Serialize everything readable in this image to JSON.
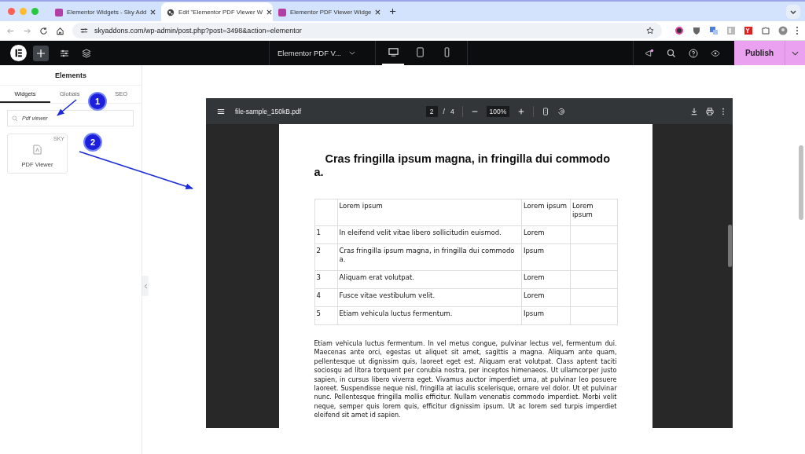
{
  "browser": {
    "tabs": [
      {
        "title": "Elementor Widgets - Sky Add",
        "kind": "brand",
        "selected": false
      },
      {
        "title": "Edit \"Elementor PDF Viewer W",
        "kind": "globe",
        "selected": true
      },
      {
        "title": "Elementor PDF Viewer Widge",
        "kind": "brand",
        "selected": false
      }
    ],
    "url": "skyaddons.com/wp-admin/post.php?post=3498&action=elementor"
  },
  "editor": {
    "document_title": "Elementor PDF V...",
    "devices": [
      {
        "kind": "desktop",
        "selected": true
      },
      {
        "kind": "tablet",
        "selected": false
      },
      {
        "kind": "mobile",
        "selected": false
      }
    ],
    "publish": "Publish"
  },
  "sidebar": {
    "title": "Elements",
    "tabs": [
      {
        "label": "Widgets",
        "selected": true
      },
      {
        "label": "Globals",
        "selected": false
      },
      {
        "label": "SEO",
        "selected": false
      }
    ],
    "search": {
      "value": "Pdf viewer"
    },
    "widgets": [
      {
        "label": "PDF Viewer",
        "badge": "SKY"
      }
    ]
  },
  "annotations": [
    {
      "label": "1"
    },
    {
      "label": "2"
    }
  ],
  "pdf": {
    "filename": "file-sample_150kB.pdf",
    "page": "2",
    "separator": "/",
    "total": "4",
    "zoom": "100%",
    "heading": "Cras fringilla ipsum magna, in fringilla dui commodo a.",
    "table": {
      "columns": [
        "",
        "Lorem ipsum",
        "Lorem ipsum",
        "Lorem ipsum"
      ],
      "rows": [
        [
          "1",
          "In eleifend velit vitae libero sollicitudin euismod.",
          "Lorem",
          ""
        ],
        [
          "2",
          "Cras fringilla ipsum magna, in fringilla dui commodo a.",
          "Ipsum",
          ""
        ],
        [
          "3",
          "Aliquam erat volutpat.",
          "Lorem",
          ""
        ],
        [
          "4",
          "Fusce vitae vestibulum velit.",
          "Lorem",
          ""
        ],
        [
          "5",
          "Etiam vehicula luctus fermentum.",
          "Ipsum",
          ""
        ]
      ]
    },
    "paragraph": "Etiam vehicula luctus fermentum. In vel metus congue, pulvinar lectus vel, fermentum dui. Maecenas ante orci, egestas ut aliquet sit amet, sagittis a magna. Aliquam ante quam, pellentesque ut dignissim quis, laoreet eget est. Aliquam erat volutpat. Class aptent taciti sociosqu ad litora torquent per conubia nostra, per inceptos himenaeos. Ut ullamcorper justo sapien, in cursus libero viverra eget. Vivamus auctor imperdiet urna, at pulvinar leo posuere laoreet. Suspendisse neque nisl, fringilla at iaculis scelerisque, ornare vel dolor. Ut et pulvinar nunc. Pellentesque fringilla mollis efficitur. Nullam venenatis commodo imperdiet. Morbi velit neque, semper quis lorem quis, efficitur dignissim ipsum. Ut ac lorem sed turpis imperdiet eleifend sit amet id sapien."
  }
}
